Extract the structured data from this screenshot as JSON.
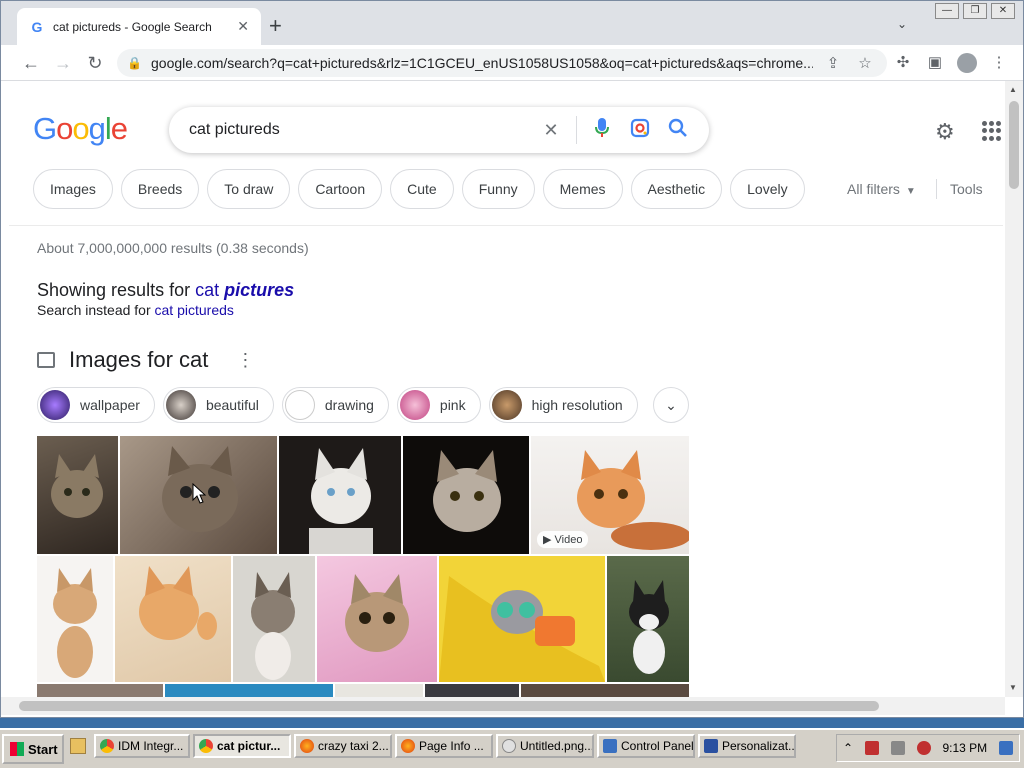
{
  "browser": {
    "tab_title": "cat pictureds - Google Search",
    "url": "google.com/search?q=cat+pictureds&rlz=1C1GCEU_enUS1058US1058&oq=cat+pictureds&aqs=chrome..."
  },
  "google": {
    "logo": [
      "G",
      "o",
      "o",
      "g",
      "l",
      "e"
    ],
    "query": "cat pictureds",
    "chips": [
      "Images",
      "Breeds",
      "To draw",
      "Cartoon",
      "Cute",
      "Funny",
      "Memes",
      "Aesthetic",
      "Lovely"
    ],
    "all_filters": "All filters",
    "tools": "Tools",
    "stats": "About 7,000,000,000 results (0.38 seconds)",
    "showing_prefix": "Showing results for ",
    "showing_plain": "cat ",
    "showing_bold": "pictures",
    "instead_prefix": "Search instead for ",
    "instead_link": "cat pictureds",
    "images_title": "Images for cat",
    "sub_chips": [
      "wallpaper",
      "beautiful",
      "drawing",
      "pink",
      "high resolution"
    ],
    "video_label": "Video"
  },
  "taskbar": {
    "start": "Start",
    "tasks": [
      "IDM Integr...",
      "cat pictur...",
      "crazy taxi 2...",
      "Page Info ...",
      "Untitled.png...",
      "Control Panel",
      "Personalizat..."
    ],
    "clock": "9:13 PM"
  },
  "colors": {
    "logo_blue": "#4285f4",
    "logo_red": "#ea4335",
    "logo_yellow": "#fbbc05",
    "logo_green": "#34a853",
    "link": "#1a0dab"
  }
}
